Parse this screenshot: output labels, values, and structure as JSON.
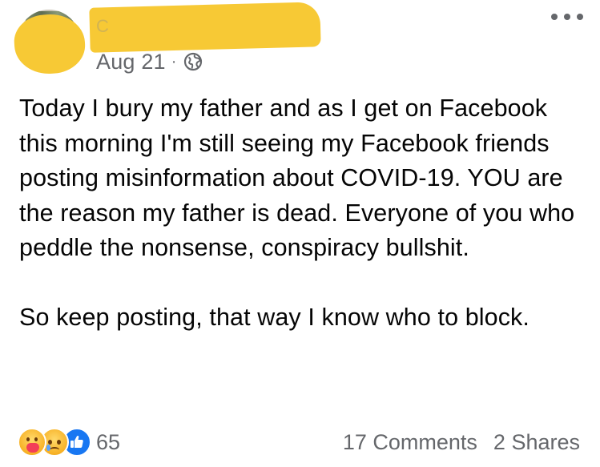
{
  "post": {
    "timestamp": "Aug 21",
    "separator": "·",
    "privacy_icon": "globe-icon",
    "author_initial": "C",
    "body_paragraphs": [
      "Today I bury my father and as I get on Facebook this morning I'm still seeing my Facebook friends posting misinformation about COVID-19. YOU are the reason my father is dead. Everyone of you who peddle the nonsense, conspiracy bullshit.",
      "So keep posting, that way I know who to block."
    ]
  },
  "footer": {
    "reaction_icons": [
      "care-icon",
      "sad-icon",
      "like-icon"
    ],
    "reaction_count": "65",
    "comments": "17 Comments",
    "shares": "2 Shares"
  },
  "colors": {
    "redaction": "#f7c935",
    "meta_text": "#65676b",
    "body_text": "#050505",
    "like_blue": "#1877f2"
  }
}
